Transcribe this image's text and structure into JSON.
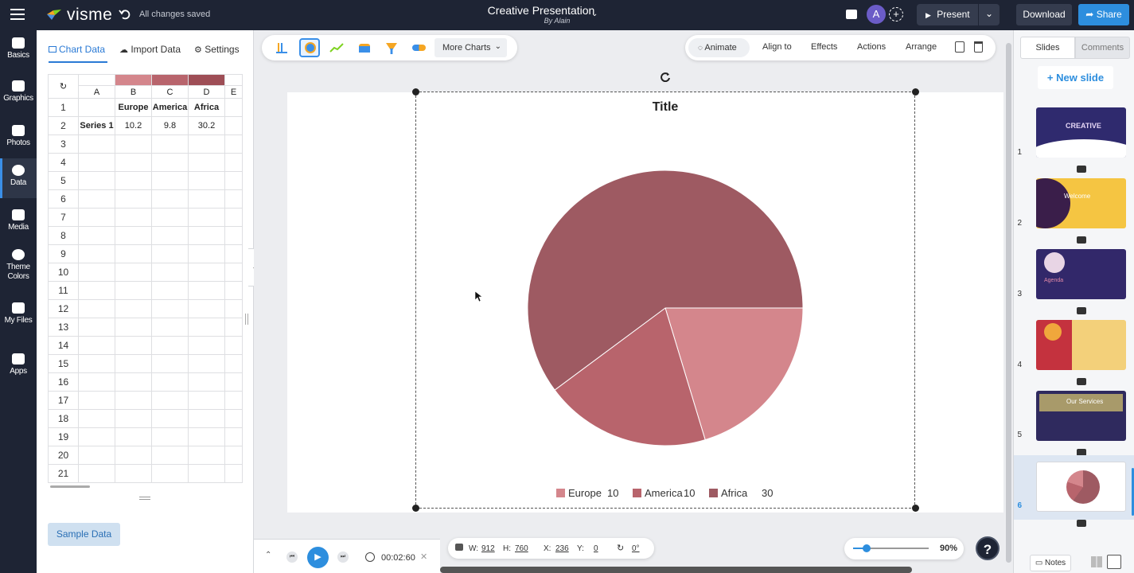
{
  "topbar": {
    "logo_text": "visme",
    "undo_icon": "undo-icon",
    "save_status": "All changes saved",
    "doc_title": "Creative Presentation",
    "doc_author": "By Alain",
    "avatar_letter": "A",
    "present_label": "Present",
    "download_label": "Download",
    "share_label": "Share"
  },
  "leftnav": {
    "items": [
      {
        "label": "Basics",
        "icon": "shapes-icon"
      },
      {
        "label": "Graphics",
        "icon": "graphics-icon"
      },
      {
        "label": "Photos",
        "icon": "photo-icon"
      },
      {
        "label": "Data",
        "icon": "pie-chart-icon"
      },
      {
        "label": "Media",
        "icon": "media-icon"
      },
      {
        "label": "Theme",
        "label2": "Colors",
        "icon": "palette-icon"
      },
      {
        "label": "My Files",
        "icon": "folder-icon"
      },
      {
        "label": "Apps",
        "icon": "apps-icon"
      }
    ]
  },
  "datapanel": {
    "tabs": [
      {
        "label": "Chart Data",
        "icon": "table-icon"
      },
      {
        "label": "Import Data",
        "icon": "cloud-upload-icon"
      },
      {
        "label": "Settings",
        "icon": "gear-icon"
      }
    ],
    "columns": [
      "A",
      "B",
      "C",
      "D",
      "E"
    ],
    "column_colors": [
      "",
      "#d4868c",
      "#b8646c",
      "#9e4e56",
      ""
    ],
    "rows": [
      [
        "",
        "Europe",
        "America",
        "Africa",
        ""
      ],
      [
        "Series 1",
        "10.2",
        "9.8",
        "30.2",
        ""
      ]
    ],
    "row_count": 21,
    "sample_data_label": "Sample Data"
  },
  "toolbar": {
    "more_charts_label": "More Charts",
    "animate_label": "Animate",
    "align_label": "Align to",
    "effects_label": "Effects",
    "actions_label": "Actions",
    "arrange_label": "Arrange"
  },
  "chart_data": {
    "type": "pie",
    "title": "Title",
    "categories": [
      "Europe",
      "America",
      "Africa"
    ],
    "values": [
      10.2,
      9.8,
      30.2
    ],
    "legend_values": [
      "10",
      "10",
      "30"
    ],
    "colors": [
      "#d4868c",
      "#b8646c",
      "#9e5a62"
    ],
    "legend_placement": "bottom"
  },
  "bottombar": {
    "timer": "00:02:60",
    "w_label": "W:",
    "w_value": "912",
    "h_label": "H:",
    "h_value": "760",
    "x_label": "X:",
    "x_value": "236",
    "y_label": "Y:",
    "y_value": "0",
    "rotation_value": "0°",
    "zoom_value": "90%",
    "zoom_fraction": 0.18,
    "help_label": "?"
  },
  "rightpanel": {
    "tab_slides": "Slides",
    "tab_comments": "Comments",
    "new_slide_label": "New slide",
    "notes_label": "Notes",
    "slides": [
      {
        "num": "1",
        "caption": "CREATIVE"
      },
      {
        "num": "2",
        "caption": "Welcome"
      },
      {
        "num": "3",
        "caption": "Agenda"
      },
      {
        "num": "4",
        "caption": ""
      },
      {
        "num": "5",
        "caption": "Our Services"
      },
      {
        "num": "6",
        "caption": ""
      }
    ]
  }
}
